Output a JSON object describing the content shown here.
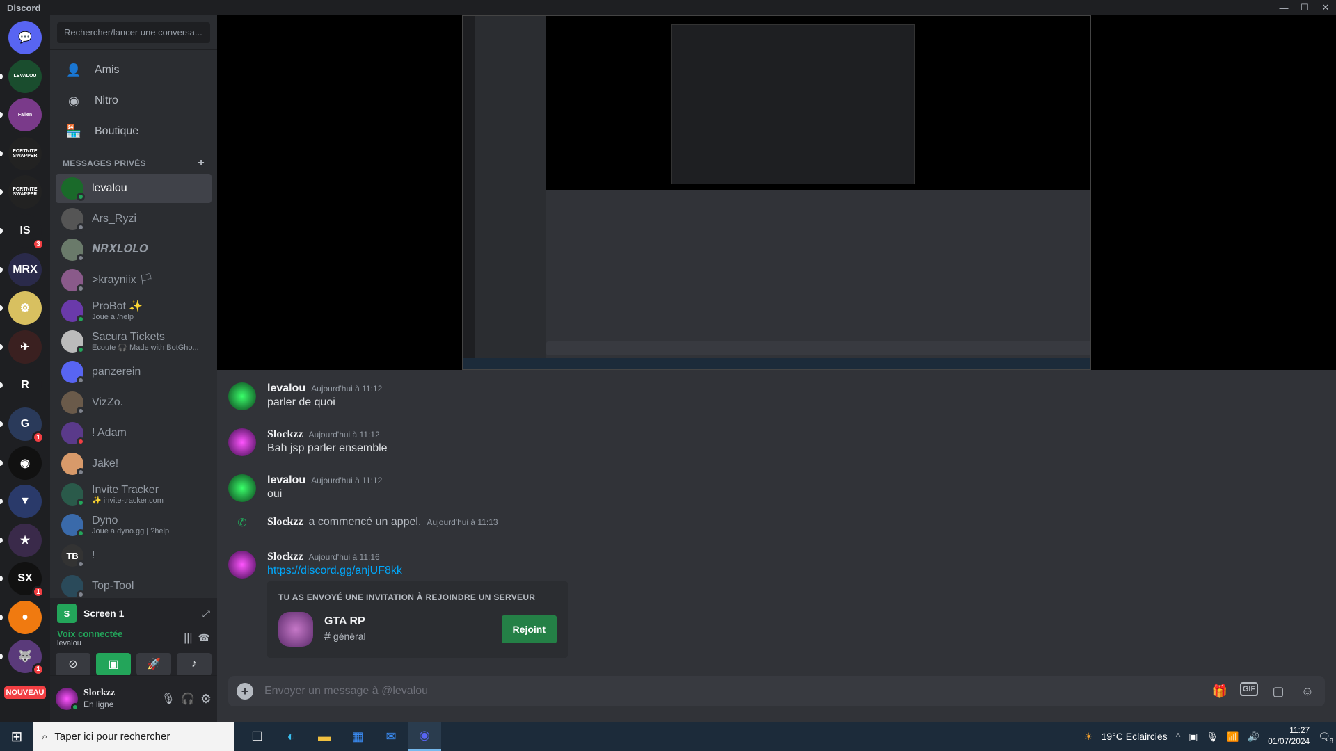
{
  "window": {
    "title": "Discord",
    "controls": [
      "—",
      "☐",
      "✕"
    ]
  },
  "guilds": [
    {
      "label": "💬",
      "bg": "#5865f2"
    },
    {
      "label": "LEVALOU",
      "bg": "#1a4d2e",
      "badge": ""
    },
    {
      "label": "Fallen",
      "bg": "#7a3a8a"
    },
    {
      "label": "FORTNITE SWAPPER",
      "bg": "#222"
    },
    {
      "label": "FORTNITE SWAPPER",
      "bg": "#222"
    },
    {
      "label": "IS",
      "bg": "#1e1f22",
      "badge": "3"
    },
    {
      "label": "MRX",
      "bg": "#2a2a4a"
    },
    {
      "label": "⚙",
      "bg": "#d8c060"
    },
    {
      "label": "✈",
      "bg": "#3a2020"
    },
    {
      "label": "R",
      "bg": "#1e1f22"
    },
    {
      "label": "G",
      "bg": "#2a3a5a",
      "badge": "1"
    },
    {
      "label": "◉",
      "bg": "#111"
    },
    {
      "label": "▼",
      "bg": "#2a3a6a"
    },
    {
      "label": "★",
      "bg": "#3a2a4a"
    },
    {
      "label": "SX",
      "bg": "#111",
      "badge": "1"
    },
    {
      "label": "●",
      "bg": "#f07a10"
    },
    {
      "label": "🐺",
      "bg": "#5a3a7a",
      "badge": "1"
    }
  ],
  "nouveau_label": "NOUVEAU",
  "search": {
    "placeholder": "Rechercher/lancer une conversa..."
  },
  "nav": [
    {
      "label": "Amis",
      "icon": "👤"
    },
    {
      "label": "Nitro",
      "icon": "◉"
    },
    {
      "label": "Boutique",
      "icon": "🏪"
    }
  ],
  "dm_header": {
    "label": "MESSAGES PRIVÉS",
    "add": "+"
  },
  "dms": [
    {
      "name": "levalou",
      "sub": "",
      "color": "#1a6a2a",
      "status": "on",
      "active": true
    },
    {
      "name": "Ars_Ryzi",
      "sub": "",
      "color": "#555",
      "status": "off"
    },
    {
      "name": "𝑵𝑹𝑿𝑳𝑶𝑳𝑶",
      "sub": "",
      "color": "#6a7a6a",
      "status": "off"
    },
    {
      "name": ">krayniix 🏳",
      "sub": "",
      "color": "#8a5a8a",
      "status": "off"
    },
    {
      "name": "ProBot ✨",
      "sub": "Joue à /help",
      "color": "#6a3aaa",
      "status": "on"
    },
    {
      "name": "Sacura Tickets",
      "sub": "Écoute 🎧 Made with BotGho...",
      "color": "#bbb",
      "status": "on"
    },
    {
      "name": "panzerein",
      "sub": "",
      "color": "#5865f2",
      "status": "off"
    },
    {
      "name": "VizZo.",
      "sub": "",
      "color": "#6a5a4a",
      "status": "off"
    },
    {
      "name": "! Adam",
      "sub": "",
      "color": "#5a3a8a",
      "status": "dnd"
    },
    {
      "name": "Jake!",
      "sub": "",
      "color": "#d89a6a",
      "status": "off"
    },
    {
      "name": "Invite Tracker",
      "sub": "✨ invite-tracker.com",
      "color": "#2a5a4a",
      "status": "on"
    },
    {
      "name": "Dyno",
      "sub": "Joue à dyno.gg | ?help",
      "color": "#3a6aaa",
      "status": "on"
    },
    {
      "name": "!",
      "sub": "",
      "color": "#333",
      "status": "off",
      "initials": "TB"
    },
    {
      "name": "Top-Tool",
      "sub": "",
      "color": "#2a4a5a",
      "status": "off"
    }
  ],
  "stream_panel": {
    "title": "Screen 1",
    "voice_status": "Voix connectée",
    "voice_channel": "levalou"
  },
  "user": {
    "name": "Slockzz",
    "status": "En ligne"
  },
  "messages": [
    {
      "author": "levalou",
      "time": "Aujourd'hui à 11:12",
      "text": "parler de quoi",
      "color": "#1a6a2a"
    },
    {
      "author": "Slockzz",
      "time": "Aujourd'hui à 11:12",
      "text": "Bah jsp parler ensemble",
      "color": "#b03ab0"
    },
    {
      "author": "levalou",
      "time": "Aujourd'hui à 11:12",
      "text": "oui",
      "color": "#1a6a2a"
    }
  ],
  "call_event": {
    "author": "Slockzz",
    "text": "a commencé un appel.",
    "time": "Aujourd'hui à 11:13"
  },
  "last_message": {
    "author": "Slockzz",
    "time": "Aujourd'hui à 11:16",
    "link": "https://discord.gg/anjUF8kk"
  },
  "invite": {
    "title": "TU AS ENVOYÉ UNE INVITATION À REJOINDRE UN SERVEUR",
    "server": "GTA RP",
    "channel": "général",
    "button": "Rejoint"
  },
  "composer": {
    "placeholder": "Envoyer un message à @levalou"
  },
  "taskbar": {
    "search_placeholder": "Taper ici pour rechercher",
    "weather": "19°C  Eclaircies",
    "time": "11:27",
    "date": "01/07/2024",
    "notifications": "8"
  }
}
